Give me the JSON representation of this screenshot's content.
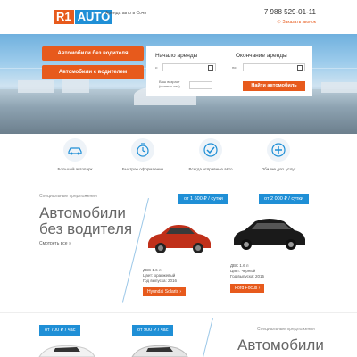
{
  "header": {
    "logo_left": "R1",
    "logo_right": "AUTO",
    "tagline": "Аренда авто в Сочи",
    "phone": "+7 988 529-01-11",
    "callback_label": "Заказать звонок",
    "callback_icon": "phone-icon"
  },
  "hero": {
    "btn_no_driver": "Автомобили без водителя",
    "btn_with_driver": "Автомобили с водителем",
    "form": {
      "start_label": "Начало аренды",
      "end_label": "Окончание аренды",
      "from_prefix": "с:",
      "to_prefix": "по:",
      "age_label": "Ваш возраст (полных лет)",
      "find_button": "Найти автомобиль"
    }
  },
  "features": [
    {
      "label": "Большой автопарк",
      "icon": "car-icon"
    },
    {
      "label": "Быстрое оформление",
      "icon": "stopwatch-icon"
    },
    {
      "label": "Всегда исправные авто",
      "icon": "checkmark-icon"
    },
    {
      "label": "Обилие доп. услуг",
      "icon": "plus-icon"
    }
  ],
  "section_no_driver": {
    "kicker": "Специальные предложения",
    "title_line1": "Автомобили",
    "title_line2": "без водителя",
    "more_link": "Смотреть все »",
    "cars": [
      {
        "price": "от 1 600 ₽ / сутки",
        "engine": "ДВС 1.6 л",
        "color": "Цвет: оранжевый",
        "year": "Год выпуска: 2016",
        "model": "Hyundai Solaris",
        "car_color": "#c0301a"
      },
      {
        "price": "от 2 000 ₽ / сутки",
        "engine": "ДВС 1.6 л",
        "color": "Цвет: черный",
        "year": "Год выпуска: 2015",
        "model": "Ford Focus",
        "car_color": "#1a1a1a"
      }
    ]
  },
  "section_with_driver": {
    "kicker": "Специальные предложения",
    "title_line1": "Автомобили",
    "prices": [
      "от 700 ₽ / час",
      "от 900 ₽ / час"
    ]
  },
  "colors": {
    "accent_orange": "#e75a1c",
    "accent_blue": "#1f8fd6"
  }
}
